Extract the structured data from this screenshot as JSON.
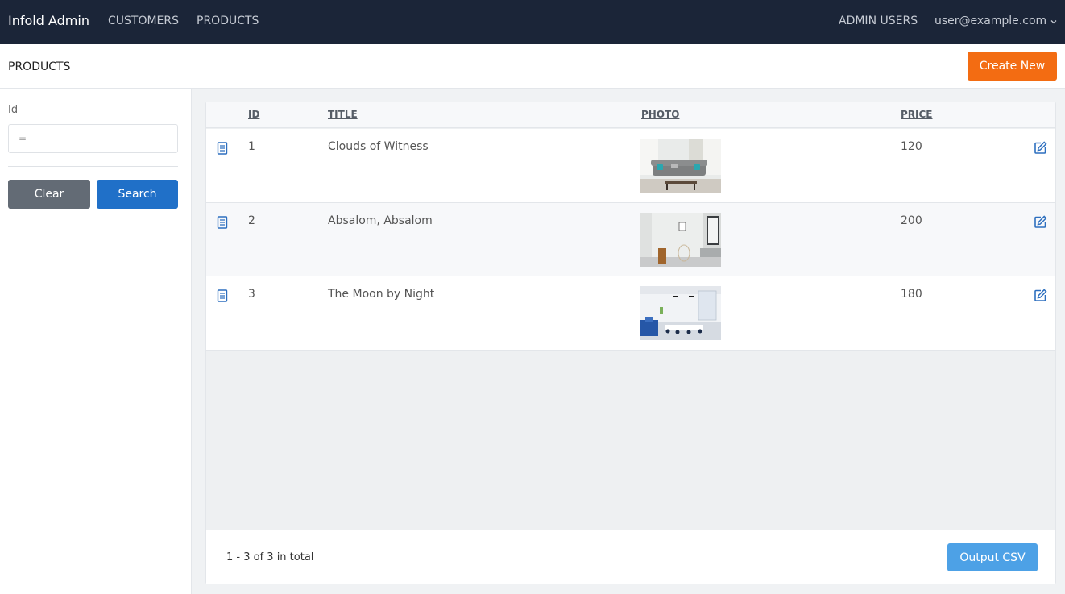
{
  "navbar": {
    "brand": "Infold Admin",
    "links": [
      "CUSTOMERS",
      "PRODUCTS"
    ],
    "admin_users": "ADMIN USERS",
    "user_email": "user@example.com"
  },
  "header": {
    "title": "PRODUCTS",
    "create_label": "Create New"
  },
  "filter": {
    "id_label": "Id",
    "id_placeholder": "=",
    "clear_label": "Clear",
    "search_label": "Search"
  },
  "table": {
    "columns": [
      "ID",
      "TITLE",
      "PHOTO",
      "PRICE"
    ],
    "rows": [
      {
        "id": "1",
        "title": "Clouds of Witness",
        "price": "120"
      },
      {
        "id": "2",
        "title": "Absalom, Absalom",
        "price": "200"
      },
      {
        "id": "3",
        "title": "The Moon by Night",
        "price": "180"
      }
    ]
  },
  "footer": {
    "pager": "1 - 3 of 3 in total",
    "csv_label": "Output CSV"
  },
  "colors": {
    "navbar_bg": "#1b2538",
    "accent_orange": "#f36c12",
    "primary_blue": "#2070c8",
    "csv_blue": "#4da1e6",
    "clear_gray": "#636b75"
  }
}
